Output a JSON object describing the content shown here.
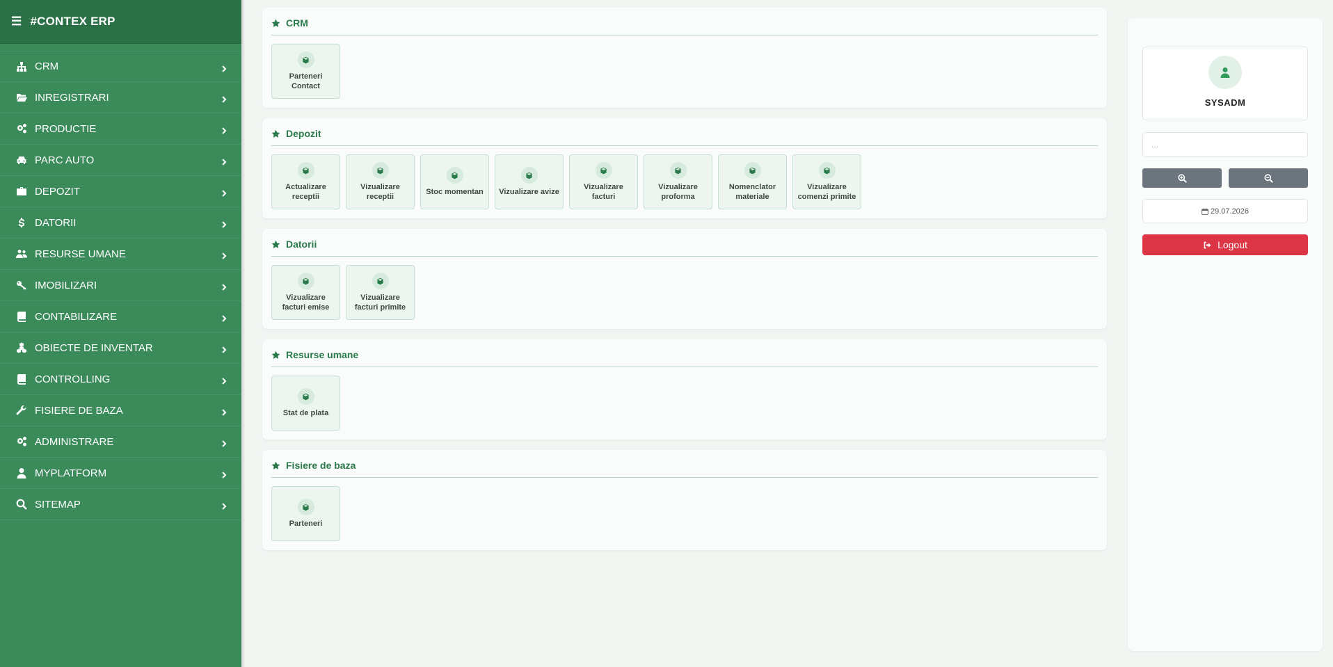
{
  "app": {
    "title": "#CONTEX ERP"
  },
  "sidebar": {
    "items": [
      {
        "label": "CRM",
        "icon": "sitemap-icon"
      },
      {
        "label": "INREGISTRARI",
        "icon": "folder-open-icon"
      },
      {
        "label": "PRODUCTIE",
        "icon": "cogs-icon"
      },
      {
        "label": "PARC AUTO",
        "icon": "car-icon"
      },
      {
        "label": "DEPOZIT",
        "icon": "briefcase-icon"
      },
      {
        "label": "DATORII",
        "icon": "dollar-icon"
      },
      {
        "label": "RESURSE UMANE",
        "icon": "users-icon"
      },
      {
        "label": "IMOBILIZARI",
        "icon": "key-icon"
      },
      {
        "label": "CONTABILIZARE",
        "icon": "book-icon"
      },
      {
        "label": "OBIECTE DE INVENTAR",
        "icon": "cubes-icon"
      },
      {
        "label": "CONTROLLING",
        "icon": "book-icon"
      },
      {
        "label": "FISIERE DE BAZA",
        "icon": "wrench-icon"
      },
      {
        "label": "ADMINISTRARE",
        "icon": "cogs-icon"
      },
      {
        "label": "MYPLATFORM",
        "icon": "user-icon"
      },
      {
        "label": "SITEMAP",
        "icon": "search-icon"
      }
    ]
  },
  "sections": [
    {
      "title": "CRM",
      "tiles": [
        "Parteneri Contact"
      ]
    },
    {
      "title": "Depozit",
      "tiles": [
        "Actualizare receptii",
        "Vizualizare receptii",
        "Stoc momentan",
        "Vizualizare avize",
        "Vizualizare facturi",
        "Vizualizare proforma",
        "Nomenclator materiale",
        "Vizualizare comenzi primite"
      ]
    },
    {
      "title": "Datorii",
      "tiles": [
        "Vizualizare facturi emise",
        "Vizualizare facturi primite"
      ]
    },
    {
      "title": "Resurse umane",
      "tiles": [
        "Stat de plata"
      ]
    },
    {
      "title": "Fisiere de baza",
      "tiles": [
        "Parteneri"
      ]
    }
  ],
  "right_panel": {
    "username": "SYSADM",
    "search_placeholder": "...",
    "date": "29.07.2026",
    "logout_label": "Logout"
  },
  "colors": {
    "sidebar": "#3a8a5a",
    "sidebar_header": "#2c7047",
    "accent": "#2b7a4b",
    "logout": "#dc3545",
    "zoom_buttons": "#6c757d"
  }
}
